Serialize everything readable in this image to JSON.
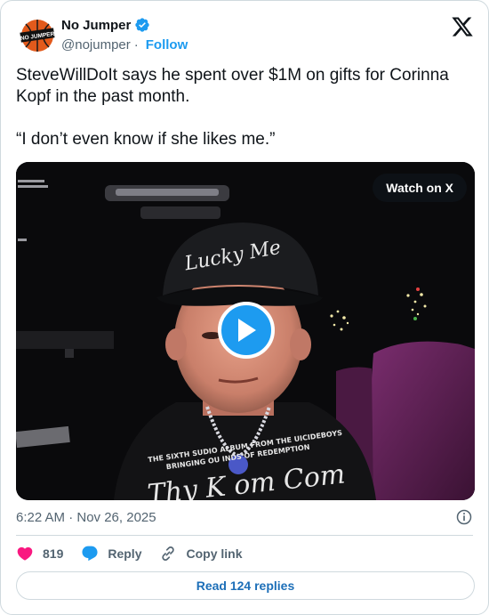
{
  "author": {
    "display_name": "No Jumper",
    "handle": "@nojumper",
    "separator": "·",
    "follow_label": "Follow",
    "avatar_text": "NO JUMPER",
    "verified": true
  },
  "tweet": {
    "text_line1": "SteveWillDoIt says he spent over $1M on gifts for Corinna Kopf in the past month.",
    "text_line2": "“I don’t even know if she likes me.”"
  },
  "media": {
    "watch_label": "Watch on X",
    "shirt_text_1": "THE SIXTH SUDIO  ALBUM FROM THE UICIDEBOYS",
    "shirt_text_2": "BRINGING OU  INDS OF REDEMPTION",
    "shirt_script": "Thy K  om Com",
    "cap_text": "Lucky Me"
  },
  "timestamp": "6:22 AM · Nov 26, 2025",
  "actions": {
    "likes_count": "819",
    "reply_label": "Reply",
    "copy_link_label": "Copy link"
  },
  "read_replies_label": "Read 124 replies",
  "colors": {
    "accent": "#1d9bf0",
    "like": "#f91880",
    "text": "#0f1419",
    "muted": "#536471",
    "border": "#cfd9de"
  }
}
